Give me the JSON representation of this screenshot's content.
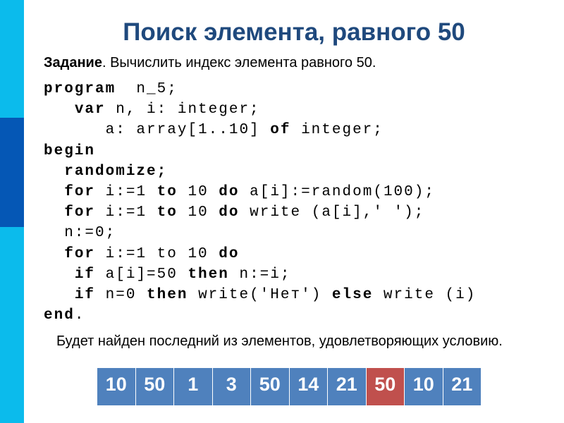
{
  "title": "Поиск элемента, равного 50",
  "task": {
    "label": "Задание",
    "text": ". Вычислить индекс элемента равного 50."
  },
  "code_lines": [
    [
      {
        "t": "program",
        "b": true
      },
      {
        "t": "  n_5;",
        "b": false
      }
    ],
    [
      {
        "t": "   ",
        "b": false
      },
      {
        "t": "var",
        "b": true
      },
      {
        "t": " n, i: integer;",
        "b": false
      }
    ],
    [
      {
        "t": "      a: array[1..10] ",
        "b": false
      },
      {
        "t": "of",
        "b": true
      },
      {
        "t": " integer;",
        "b": false
      }
    ],
    [
      {
        "t": "begin",
        "b": true
      }
    ],
    [
      {
        "t": "  ",
        "b": false
      },
      {
        "t": "randomize;",
        "b": true
      }
    ],
    [
      {
        "t": "  ",
        "b": false
      },
      {
        "t": "for",
        "b": true
      },
      {
        "t": " i:=1 ",
        "b": false
      },
      {
        "t": "to",
        "b": true
      },
      {
        "t": " 10 ",
        "b": false
      },
      {
        "t": "do",
        "b": true
      },
      {
        "t": " a[i]:=random(100);",
        "b": false
      }
    ],
    [
      {
        "t": "  ",
        "b": false
      },
      {
        "t": "for",
        "b": true
      },
      {
        "t": " i:=1 ",
        "b": false
      },
      {
        "t": "to",
        "b": true
      },
      {
        "t": " 10 ",
        "b": false
      },
      {
        "t": "do",
        "b": true
      },
      {
        "t": " write (a[i],' ');",
        "b": false
      }
    ],
    [
      {
        "t": "  n:=0;",
        "b": false
      }
    ],
    [
      {
        "t": "  ",
        "b": false
      },
      {
        "t": "for",
        "b": true
      },
      {
        "t": " i:=1 to 10 ",
        "b": false
      },
      {
        "t": "do",
        "b": true
      }
    ],
    [
      {
        "t": "   ",
        "b": false
      },
      {
        "t": "if",
        "b": true
      },
      {
        "t": " a[i]=50 ",
        "b": false
      },
      {
        "t": "then",
        "b": true
      },
      {
        "t": " n:=i;",
        "b": false
      }
    ],
    [
      {
        "t": "   ",
        "b": false
      },
      {
        "t": "if",
        "b": true
      },
      {
        "t": " n=0 ",
        "b": false
      },
      {
        "t": "then",
        "b": true
      },
      {
        "t": " write('Нет') ",
        "b": false
      },
      {
        "t": "else",
        "b": true
      },
      {
        "t": " write (i)",
        "b": false
      }
    ],
    [
      {
        "t": "end",
        "b": true
      },
      {
        "t": ".",
        "b": false
      }
    ]
  ],
  "note": "Будет найден последний из элементов, удовлетворяющих условию.",
  "array": {
    "values": [
      "10",
      "50",
      "1",
      "3",
      "50",
      "14",
      "21",
      "50",
      "10",
      "21"
    ],
    "highlighted_index": 7,
    "cell_color": "#4f81bd",
    "highlight_color": "#c0504d"
  },
  "colors": {
    "title": "#1f497d",
    "sidebar": "#0bbbec",
    "sidebar_accent": "#0557b5"
  }
}
